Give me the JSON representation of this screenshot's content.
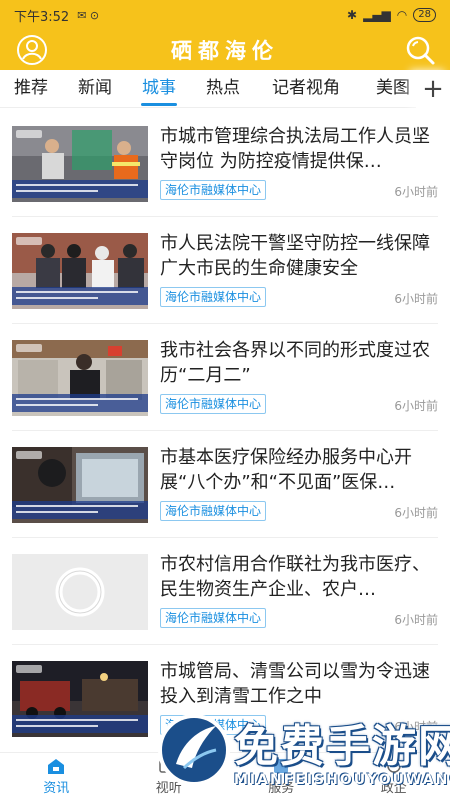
{
  "status_bar": {
    "time": "下午3:52",
    "battery": "28"
  },
  "header": {
    "title": "硒都海伦"
  },
  "tabs": [
    {
      "label": "推荐"
    },
    {
      "label": "新闻"
    },
    {
      "label": "城事"
    },
    {
      "label": "热点"
    },
    {
      "label": "记者视角"
    },
    {
      "label": "美图"
    }
  ],
  "active_tab": "城事",
  "news": [
    {
      "title": "市城市管理综合执法局工作人员坚守岗位 为防控疫情提供保…",
      "source": "海伦市融媒体中心",
      "time": "6小时前"
    },
    {
      "title": "市人民法院干警坚守防控一线保障广大市民的生命健康安全",
      "source": "海伦市融媒体中心",
      "time": "6小时前"
    },
    {
      "title": "我市社会各界以不同的形式度过农历“二月二”",
      "source": "海伦市融媒体中心",
      "time": "6小时前"
    },
    {
      "title": "市基本医疗保险经办服务中心开展“八个办”和“不见面”医保…",
      "source": "海伦市融媒体中心",
      "time": "6小时前"
    },
    {
      "title": "市农村信用合作联社为我市医疗、民生物资生产企业、农户…",
      "source": "海伦市融媒体中心",
      "time": "6小时前"
    },
    {
      "title": "市城管局、清雪公司以雪为令迅速投入到清雪工作之中",
      "source": "海伦市融媒体中心",
      "time": "6小时前"
    }
  ],
  "bottom_nav": [
    {
      "label": "资讯"
    },
    {
      "label": "视听"
    },
    {
      "label": "服务"
    },
    {
      "label": "政企"
    }
  ],
  "watermark": {
    "text": "免费手游网",
    "sub": "MIANFEISHOUYOUWANG"
  },
  "colors": {
    "brand": "#f6c21b",
    "accent": "#1a8fe0"
  }
}
